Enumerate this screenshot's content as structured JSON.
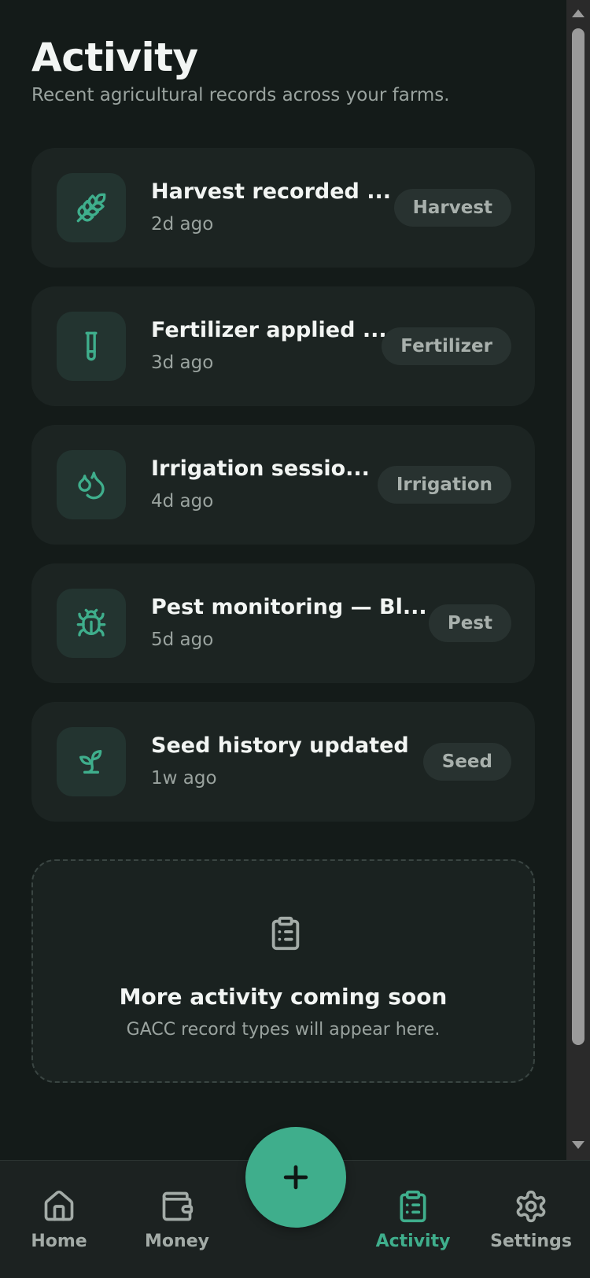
{
  "header": {
    "title": "Activity",
    "subtitle": "Recent agricultural records across your farms."
  },
  "activities": [
    {
      "title": "Harvest recorded ...",
      "time": "2d ago",
      "badge": "Harvest",
      "icon": "wheat-icon"
    },
    {
      "title": "Fertilizer applied ...",
      "time": "3d ago",
      "badge": "Fertilizer",
      "icon": "test-tube-icon"
    },
    {
      "title": "Irrigation sessio...",
      "time": "4d ago",
      "badge": "Irrigation",
      "icon": "droplets-icon"
    },
    {
      "title": "Pest monitoring — Bl...",
      "time": "5d ago",
      "badge": "Pest",
      "icon": "bug-icon"
    },
    {
      "title": "Seed history updated",
      "time": "1w ago",
      "badge": "Seed",
      "icon": "sprout-icon"
    }
  ],
  "empty_state": {
    "title": "More activity coming soon",
    "subtitle": "GACC record types will appear here.",
    "icon": "clipboard-list-icon"
  },
  "nav": {
    "home": "Home",
    "money": "Money",
    "activity": "Activity",
    "settings": "Settings",
    "active": "Activity"
  },
  "colors": {
    "background": "#141b19",
    "card": "#1c2422",
    "accent": "#3fae8c",
    "icon_tile": "#233430"
  }
}
